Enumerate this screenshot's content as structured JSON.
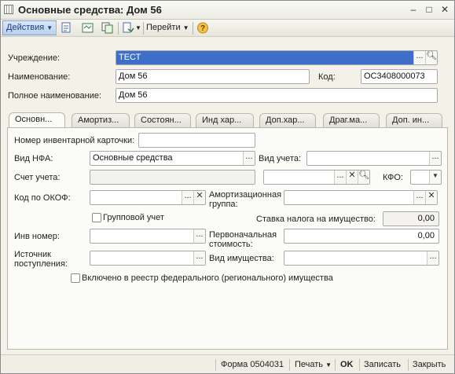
{
  "window": {
    "title": "Основные средства: Дом 56"
  },
  "toolbar": {
    "actions_label": "Действия",
    "goto_label": "Перейти"
  },
  "header": {
    "institution_label": "Учреждение:",
    "institution_value": "ТЕСТ",
    "name_label": "Наименование:",
    "name_value": "Дом 56",
    "code_label": "Код:",
    "code_value": "ОС3408000073",
    "full_name_label": "Полное наименование:",
    "full_name_value": "Дом 56"
  },
  "tabs": [
    {
      "label": "Основн..."
    },
    {
      "label": "Амортиз..."
    },
    {
      "label": "Состоян..."
    },
    {
      "label": "Инд хар..."
    },
    {
      "label": "Доп.хар..."
    },
    {
      "label": "Драг.ма..."
    },
    {
      "label": "Доп. ин..."
    }
  ],
  "main": {
    "inv_card_label": "Номер инвентарной карточки:",
    "inv_card_value": "",
    "nfa_type_label": "Вид НФА:",
    "nfa_type_value": "Основные средства",
    "accounting_type_label": "Вид учета:",
    "accounting_type_value": "",
    "account_label": "Счет учета:",
    "account_value": "",
    "kfo_label": "КФО:",
    "kfo_value": "",
    "okof_label": "Код по ОКОФ:",
    "okof_value": "",
    "amort_group_label": "Амортизационная группа:",
    "amort_group_value": "",
    "group_account_label": "Групповой учет",
    "group_account_checked": false,
    "tax_rate_label": "Ставка налога на имущество:",
    "tax_rate_value": "0,00",
    "inv_number_label": "Инв номер:",
    "inv_number_value": "",
    "initial_cost_label": "Первоначальная стоимость:",
    "initial_cost_value": "0,00",
    "source_label": "Источник поступления:",
    "source_value": "",
    "property_type_label": "Вид имущества:",
    "property_type_value": "",
    "registry_label": "Включено в реестр федерального (регионального) имущества",
    "registry_checked": false
  },
  "statusbar": {
    "form_label": "Форма 0504031",
    "print_label": "Печать",
    "ok_label": "OK",
    "save_label": "Записать",
    "close_label": "Закрыть"
  },
  "colors": {
    "selection": "#3d6fc9",
    "actions_button": "#b9cfee",
    "background": "#f3f1e8"
  }
}
